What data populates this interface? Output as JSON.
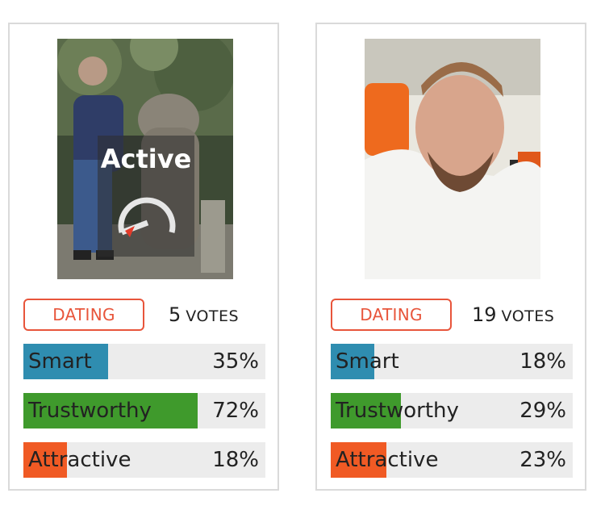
{
  "colors": {
    "accent": "#e8553b",
    "smart": "#2f8db0",
    "trustworthy": "#3f9a2c",
    "attractive": "#f05a24",
    "track": "#ececec"
  },
  "profiles": [
    {
      "overlay_label": "Active",
      "category": "DATING",
      "votes_count": "5",
      "votes_label": "VOTES",
      "traits": [
        {
          "name": "Smart",
          "percent": "35%",
          "fill": 0.35
        },
        {
          "name": "Trustworthy",
          "percent": "72%",
          "fill": 0.72
        },
        {
          "name": "Attractive",
          "percent": "18%",
          "fill": 0.18
        }
      ]
    },
    {
      "category": "DATING",
      "votes_count": "19",
      "votes_label": "VOTES",
      "traits": [
        {
          "name": "Smart",
          "percent": "18%",
          "fill": 0.18
        },
        {
          "name": "Trustworthy",
          "percent": "29%",
          "fill": 0.29
        },
        {
          "name": "Attractive",
          "percent": "23%",
          "fill": 0.23
        }
      ]
    }
  ]
}
